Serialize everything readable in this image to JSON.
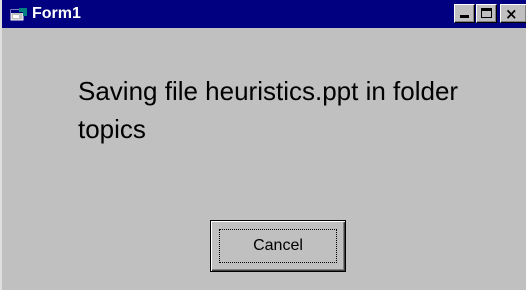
{
  "window": {
    "title": "Form1",
    "title_icon": "form-window-icon",
    "controls": {
      "minimize_icon": "minimize-icon",
      "maximize_icon": "maximize-icon",
      "close_icon": "close-icon",
      "close_glyph": "×"
    }
  },
  "content": {
    "message": "Saving file heuristics.ppt in folder topics"
  },
  "buttons": {
    "cancel_label": "Cancel"
  },
  "colors": {
    "titlebar": "#000080",
    "face": "#c0c0c0",
    "title_text": "#ffffff"
  }
}
